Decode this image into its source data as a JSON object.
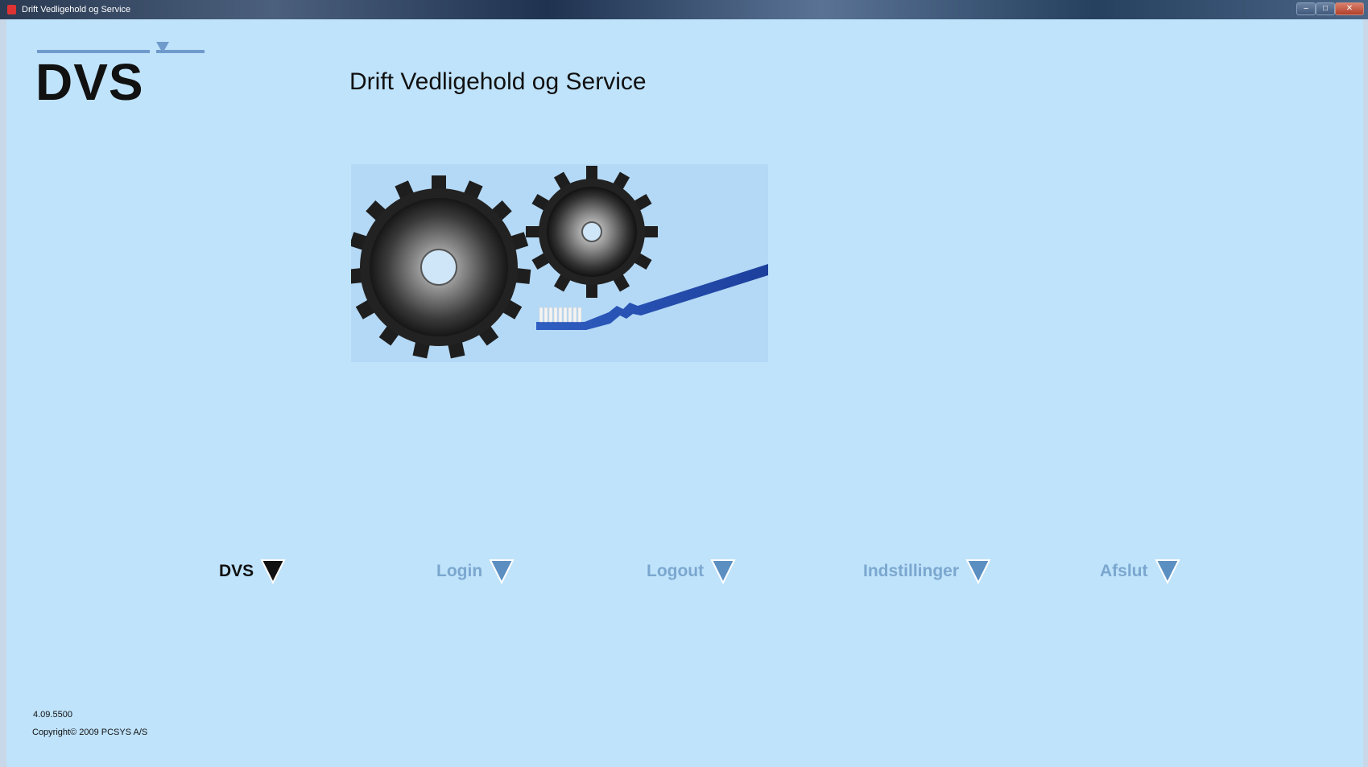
{
  "window": {
    "title": "Drift Vedligehold og Service",
    "controls": {
      "minimize": "–",
      "maximize": "□",
      "close": "✕"
    }
  },
  "header": {
    "logo_text": "DVS",
    "title": "Drift Vedligehold og Service"
  },
  "hero": {
    "icons": [
      "large-gear-icon",
      "small-gear-icon",
      "toothbrush-icon"
    ]
  },
  "nav": {
    "items": [
      {
        "label": "DVS",
        "active": true
      },
      {
        "label": "Login",
        "active": false
      },
      {
        "label": "Logout",
        "active": false
      },
      {
        "label": "Indstillinger",
        "active": false
      },
      {
        "label": "Afslut",
        "active": false
      }
    ]
  },
  "footer": {
    "version": "4.09.5500",
    "copyright": "Copyright© 2009 PCSYS A/S"
  },
  "colors": {
    "background": "#bfe3fb",
    "nav_inactive": "#7ba7cf",
    "nav_active": "#111111",
    "triangle_blue": "#5b8fc2",
    "logo_line": "#6f9acb"
  }
}
